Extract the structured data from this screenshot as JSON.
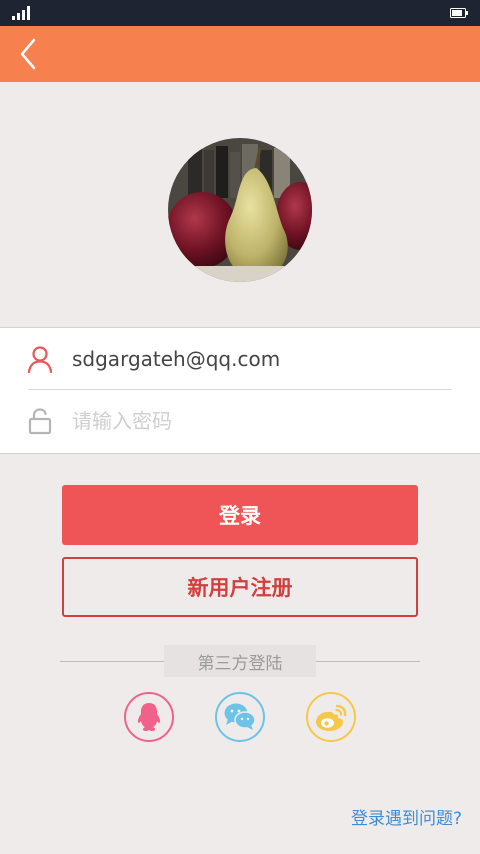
{
  "form": {
    "username_value": "sdgargateh@qq.com",
    "password_placeholder": "请输入密码"
  },
  "buttons": {
    "login_label": "登录",
    "register_label": "新用户注册"
  },
  "third_party": {
    "label": "第三方登陆",
    "providers": [
      "qq-icon",
      "wechat-icon",
      "weibo-icon"
    ]
  },
  "help": {
    "link_label": "登录遇到问题?"
  },
  "colors": {
    "status_bar": "#1f2433",
    "app_bar": "#f7804f",
    "background": "#efebeb",
    "primary": "#ef5557",
    "outline": "#d33f3f",
    "link": "#3b8fd6",
    "qq": "#f0628a",
    "wechat": "#6cc3e6",
    "weibo": "#f5c84a"
  }
}
